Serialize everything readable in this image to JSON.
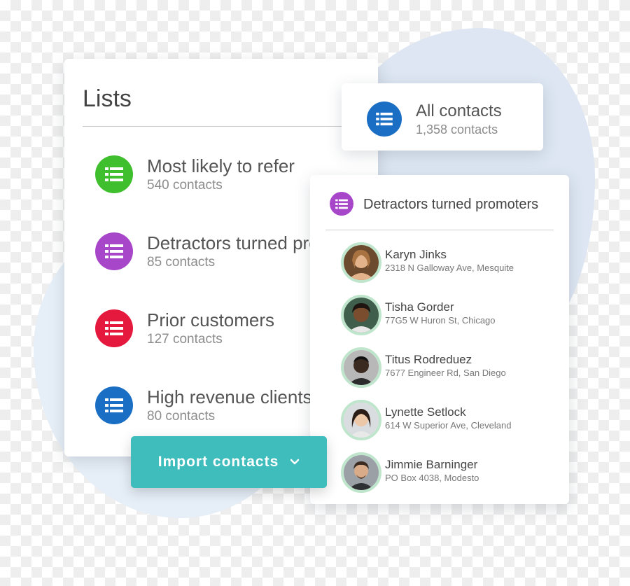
{
  "lists_panel": {
    "title": "Lists",
    "items": [
      {
        "name": "Most likely to refer",
        "count": "540 contacts",
        "color": "#3fbf2e",
        "icon": "list-icon"
      },
      {
        "name": "Detractors turned promoters",
        "count": "85 contacts",
        "color": "#a846c9",
        "icon": "list-icon"
      },
      {
        "name": "Prior customers",
        "count": "127 contacts",
        "color": "#e5183d",
        "icon": "list-icon"
      },
      {
        "name": "High revenue clients",
        "count": "80 contacts",
        "color": "#1a6fc4",
        "icon": "list-icon"
      }
    ]
  },
  "all_contacts": {
    "name": "All contacts",
    "count": "1,358 contacts",
    "color": "#1a6fc4",
    "icon": "list-icon"
  },
  "detractors_panel": {
    "title": "Detractors turned promoters",
    "color": "#a846c9",
    "contacts": [
      {
        "name": "Karyn Jinks",
        "address": "2318 N Galloway Ave, Mesquite"
      },
      {
        "name": "Tisha Gorder",
        "address": "77G5 W Huron St, Chicago"
      },
      {
        "name": "Titus Rodreduez",
        "address": "7677 Engineer Rd, San Diego"
      },
      {
        "name": "Lynette Setlock",
        "address": "614 W Superior Ave, Cleveland"
      },
      {
        "name": "Jimmie Barninger",
        "address": "PO Box 4038, Modesto"
      }
    ]
  },
  "import_button": {
    "label": "Import contacts",
    "color": "#3fbcbc",
    "icon": "chevron-down-icon"
  }
}
